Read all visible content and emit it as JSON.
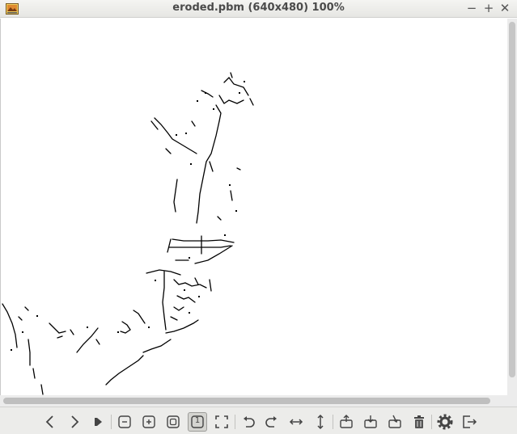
{
  "window": {
    "title": "eroded.pbm (640x480) 100%",
    "controls": {
      "minimize": "−",
      "maximize": "+",
      "close": "✕"
    }
  },
  "image": {
    "filename": "eroded.pbm",
    "size": "640x480",
    "zoom": "100%",
    "colors": {
      "background": "#ffffff",
      "pixels": "#000000"
    }
  },
  "toolbar": {
    "buttons": [
      "previous-icon",
      "next-icon",
      "slideshow-icon",
      "zoom-out-icon",
      "zoom-in-icon",
      "zoom-fit-icon",
      "zoom-original-icon",
      "fullscreen-icon",
      "rotate-left-icon",
      "rotate-right-icon",
      "flip-horizontal-icon",
      "flip-vertical-icon",
      "open-icon",
      "save-icon",
      "save-as-icon",
      "delete-icon",
      "preferences-icon",
      "quit-icon"
    ],
    "zoom_original_label": "1"
  }
}
